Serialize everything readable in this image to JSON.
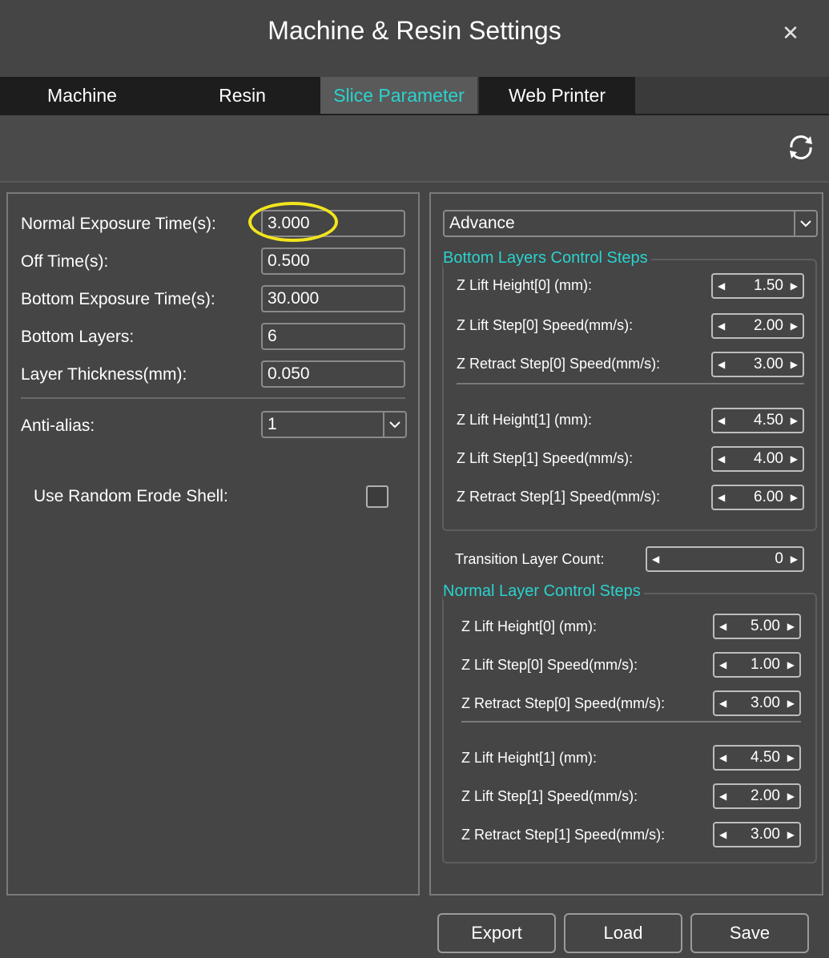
{
  "window": {
    "title": "Machine & Resin Settings",
    "close_icon": "close-icon"
  },
  "tabs": [
    {
      "label": "Machine",
      "active": false
    },
    {
      "label": "Resin",
      "active": false
    },
    {
      "label": "Slice Parameter",
      "active": true
    },
    {
      "label": "Web Printer",
      "active": false
    }
  ],
  "toolbar": {
    "refresh_icon": "refresh-icon"
  },
  "left": {
    "normal_exposure_label": "Normal Exposure Time(s):",
    "normal_exposure_value": "3.000",
    "off_time_label": "Off Time(s):",
    "off_time_value": "0.500",
    "bottom_exposure_label": "Bottom Exposure Time(s):",
    "bottom_exposure_value": "30.000",
    "bottom_layers_label": "Bottom Layers:",
    "bottom_layers_value": "6",
    "layer_thickness_label": "Layer Thickness(mm):",
    "layer_thickness_value": "0.050",
    "antialias_label": "Anti-alias:",
    "antialias_value": "1",
    "erode_label": "Use Random Erode Shell:",
    "erode_checked": false
  },
  "right": {
    "mode_value": "Advance",
    "bottom_group_title": "Bottom Layers Control Steps",
    "bottom_steps": [
      {
        "label": "Z Lift Height[0] (mm):",
        "value": "1.50"
      },
      {
        "label": "Z Lift Step[0] Speed(mm/s):",
        "value": "2.00"
      },
      {
        "label": "Z Retract Step[0] Speed(mm/s):",
        "value": "3.00"
      },
      {
        "label": "Z Lift Height[1] (mm):",
        "value": "4.50"
      },
      {
        "label": "Z Lift Step[1] Speed(mm/s):",
        "value": "4.00"
      },
      {
        "label": "Z Retract Step[1] Speed(mm/s):",
        "value": "6.00"
      }
    ],
    "transition_label": "Transition Layer Count:",
    "transition_value": "0",
    "normal_group_title": "Normal Layer Control Steps",
    "normal_steps": [
      {
        "label": "Z Lift Height[0] (mm):",
        "value": "5.00"
      },
      {
        "label": "Z Lift Step[0] Speed(mm/s):",
        "value": "1.00"
      },
      {
        "label": "Z Retract Step[0] Speed(mm/s):",
        "value": "3.00"
      },
      {
        "label": "Z Lift Height[1] (mm):",
        "value": "4.50"
      },
      {
        "label": "Z Lift Step[1] Speed(mm/s):",
        "value": "2.00"
      },
      {
        "label": "Z Retract Step[1] Speed(mm/s):",
        "value": "3.00"
      }
    ]
  },
  "footer": {
    "export_label": "Export",
    "load_label": "Load",
    "save_label": "Save"
  },
  "colors": {
    "accent": "#2ad3cf",
    "highlight": "#f2e51c",
    "background": "#454545"
  }
}
